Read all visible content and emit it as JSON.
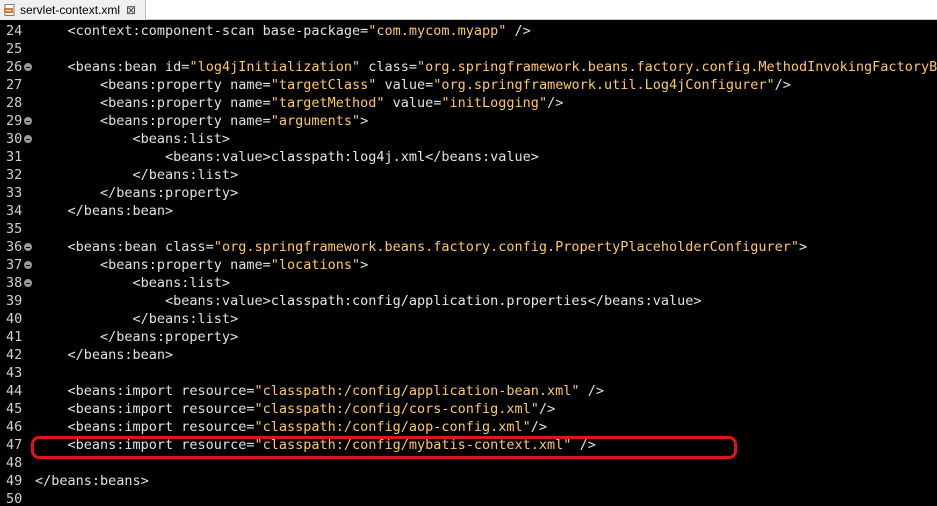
{
  "tab": {
    "label": "servlet-context.xml",
    "close_glyph": "⊠",
    "icon": "xml-file-icon"
  },
  "lines": [
    {
      "num": "24",
      "fold": false,
      "segments": [
        {
          "c": "t",
          "s": "    <context:component-scan base-package="
        },
        {
          "c": "v",
          "s": "\"com.mycom.myapp\""
        },
        {
          "c": "t",
          "s": " />"
        }
      ]
    },
    {
      "num": "25",
      "fold": false,
      "segments": []
    },
    {
      "num": "26",
      "fold": true,
      "segments": [
        {
          "c": "t",
          "s": "    <beans:bean id="
        },
        {
          "c": "v",
          "s": "\"log4jInitialization\""
        },
        {
          "c": "t",
          "s": " class="
        },
        {
          "c": "v",
          "s": "\"org.springframework.beans.factory.config.MethodInvokingFactoryBea"
        }
      ]
    },
    {
      "num": "27",
      "fold": false,
      "segments": [
        {
          "c": "t",
          "s": "        <beans:property name="
        },
        {
          "c": "v",
          "s": "\"targetClass\""
        },
        {
          "c": "t",
          "s": " value="
        },
        {
          "c": "v",
          "s": "\"org.springframework.util.Log4jConfigurer\""
        },
        {
          "c": "t",
          "s": "/>"
        }
      ]
    },
    {
      "num": "28",
      "fold": false,
      "segments": [
        {
          "c": "t",
          "s": "        <beans:property name="
        },
        {
          "c": "v",
          "s": "\"targetMethod\""
        },
        {
          "c": "t",
          "s": " value="
        },
        {
          "c": "v",
          "s": "\"initLogging\""
        },
        {
          "c": "t",
          "s": "/>"
        }
      ]
    },
    {
      "num": "29",
      "fold": true,
      "segments": [
        {
          "c": "t",
          "s": "        <beans:property name="
        },
        {
          "c": "v",
          "s": "\"arguments\""
        },
        {
          "c": "t",
          "s": ">"
        }
      ]
    },
    {
      "num": "30",
      "fold": true,
      "segments": [
        {
          "c": "t",
          "s": "            <beans:list>"
        }
      ]
    },
    {
      "num": "31",
      "fold": false,
      "segments": [
        {
          "c": "t",
          "s": "                <beans:value>"
        },
        {
          "c": "txt",
          "s": "classpath:log4j.xml"
        },
        {
          "c": "t",
          "s": "</beans:value>"
        }
      ]
    },
    {
      "num": "32",
      "fold": false,
      "segments": [
        {
          "c": "t",
          "s": "            </beans:list>"
        }
      ]
    },
    {
      "num": "33",
      "fold": false,
      "segments": [
        {
          "c": "t",
          "s": "        </beans:property>"
        }
      ]
    },
    {
      "num": "34",
      "fold": false,
      "segments": [
        {
          "c": "t",
          "s": "    </beans:bean>"
        }
      ]
    },
    {
      "num": "35",
      "fold": false,
      "segments": []
    },
    {
      "num": "36",
      "fold": true,
      "segments": [
        {
          "c": "t",
          "s": "    <beans:bean class="
        },
        {
          "c": "v",
          "s": "\"org.springframework.beans.factory.config.PropertyPlaceholderConfigurer\""
        },
        {
          "c": "t",
          "s": ">"
        }
      ]
    },
    {
      "num": "37",
      "fold": true,
      "segments": [
        {
          "c": "t",
          "s": "        <beans:property name="
        },
        {
          "c": "v",
          "s": "\"locations\""
        },
        {
          "c": "t",
          "s": ">"
        }
      ]
    },
    {
      "num": "38",
      "fold": true,
      "segments": [
        {
          "c": "t",
          "s": "            <beans:list>"
        }
      ]
    },
    {
      "num": "39",
      "fold": false,
      "segments": [
        {
          "c": "t",
          "s": "                <beans:value>"
        },
        {
          "c": "txt",
          "s": "classpath:config/application.properties"
        },
        {
          "c": "t",
          "s": "</beans:value>"
        }
      ]
    },
    {
      "num": "40",
      "fold": false,
      "segments": [
        {
          "c": "t",
          "s": "            </beans:list>"
        }
      ]
    },
    {
      "num": "41",
      "fold": false,
      "segments": [
        {
          "c": "t",
          "s": "        </beans:property>"
        }
      ]
    },
    {
      "num": "42",
      "fold": false,
      "segments": [
        {
          "c": "t",
          "s": "    </beans:bean>"
        }
      ]
    },
    {
      "num": "43",
      "fold": false,
      "segments": []
    },
    {
      "num": "44",
      "fold": false,
      "segments": [
        {
          "c": "t",
          "s": "    <beans:import resource="
        },
        {
          "c": "v",
          "s": "\"classpath:/config/application-bean.xml\""
        },
        {
          "c": "t",
          "s": " />"
        }
      ]
    },
    {
      "num": "45",
      "fold": false,
      "segments": [
        {
          "c": "t",
          "s": "    <beans:import resource="
        },
        {
          "c": "v",
          "s": "\"classpath:/config/cors-config.xml\""
        },
        {
          "c": "t",
          "s": "/>"
        }
      ]
    },
    {
      "num": "46",
      "fold": false,
      "segments": [
        {
          "c": "t",
          "s": "    <beans:import resource="
        },
        {
          "c": "v",
          "s": "\"classpath:/config/aop-config.xml\""
        },
        {
          "c": "t",
          "s": "/>"
        }
      ]
    },
    {
      "num": "47",
      "fold": false,
      "segments": [
        {
          "c": "t",
          "s": "    <beans:import resource="
        },
        {
          "c": "v",
          "s": "\"classpath:/config/mybatis-context.xml\""
        },
        {
          "c": "t",
          "s": " />"
        }
      ]
    },
    {
      "num": "48",
      "fold": false,
      "segments": []
    },
    {
      "num": "49",
      "fold": false,
      "segments": [
        {
          "c": "t",
          "s": "</beans:beans>"
        }
      ]
    },
    {
      "num": "50",
      "fold": false,
      "segments": []
    }
  ],
  "highlighted_line": "47",
  "colors": {
    "background": "#000000",
    "tag": "#e0e2e4",
    "attribute_value": "#ffc66d",
    "line_number": "#d0d0d0",
    "highlight_box": "#e0141e"
  }
}
